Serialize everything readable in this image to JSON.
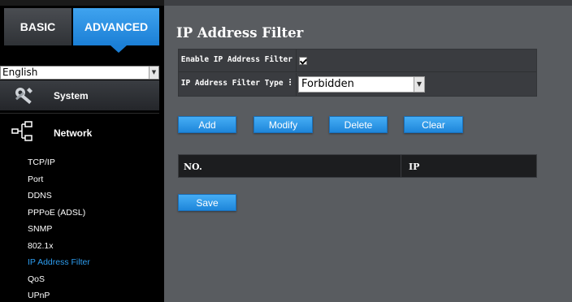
{
  "sidebar": {
    "tab_basic": "BASIC",
    "tab_advanced": "ADVANCED",
    "language": "English",
    "system_label": "System",
    "network_label": "Network",
    "network_items": [
      {
        "label": "TCP/IP",
        "active": false
      },
      {
        "label": "Port",
        "active": false
      },
      {
        "label": "DDNS",
        "active": false
      },
      {
        "label": "PPPoE (ADSL)",
        "active": false
      },
      {
        "label": "SNMP",
        "active": false
      },
      {
        "label": "802.1x",
        "active": false
      },
      {
        "label": "IP Address Filter",
        "active": true
      },
      {
        "label": "QoS",
        "active": false
      },
      {
        "label": "UPnP",
        "active": false
      }
    ]
  },
  "main": {
    "title": "IP Address Filter",
    "enable_label": "Enable IP Address Filter :",
    "enable_checked": true,
    "type_label": "IP Address Filter Type :",
    "type_value": "Forbidden",
    "buttons": {
      "add": "Add",
      "modify": "Modify",
      "delete": "Delete",
      "clear": "Clear",
      "save": "Save"
    },
    "table": {
      "col_no": "NO.",
      "col_ip": "IP"
    }
  },
  "colors": {
    "accent": "#1e86da",
    "active_link": "#2d9df0",
    "background": "#595c60"
  }
}
